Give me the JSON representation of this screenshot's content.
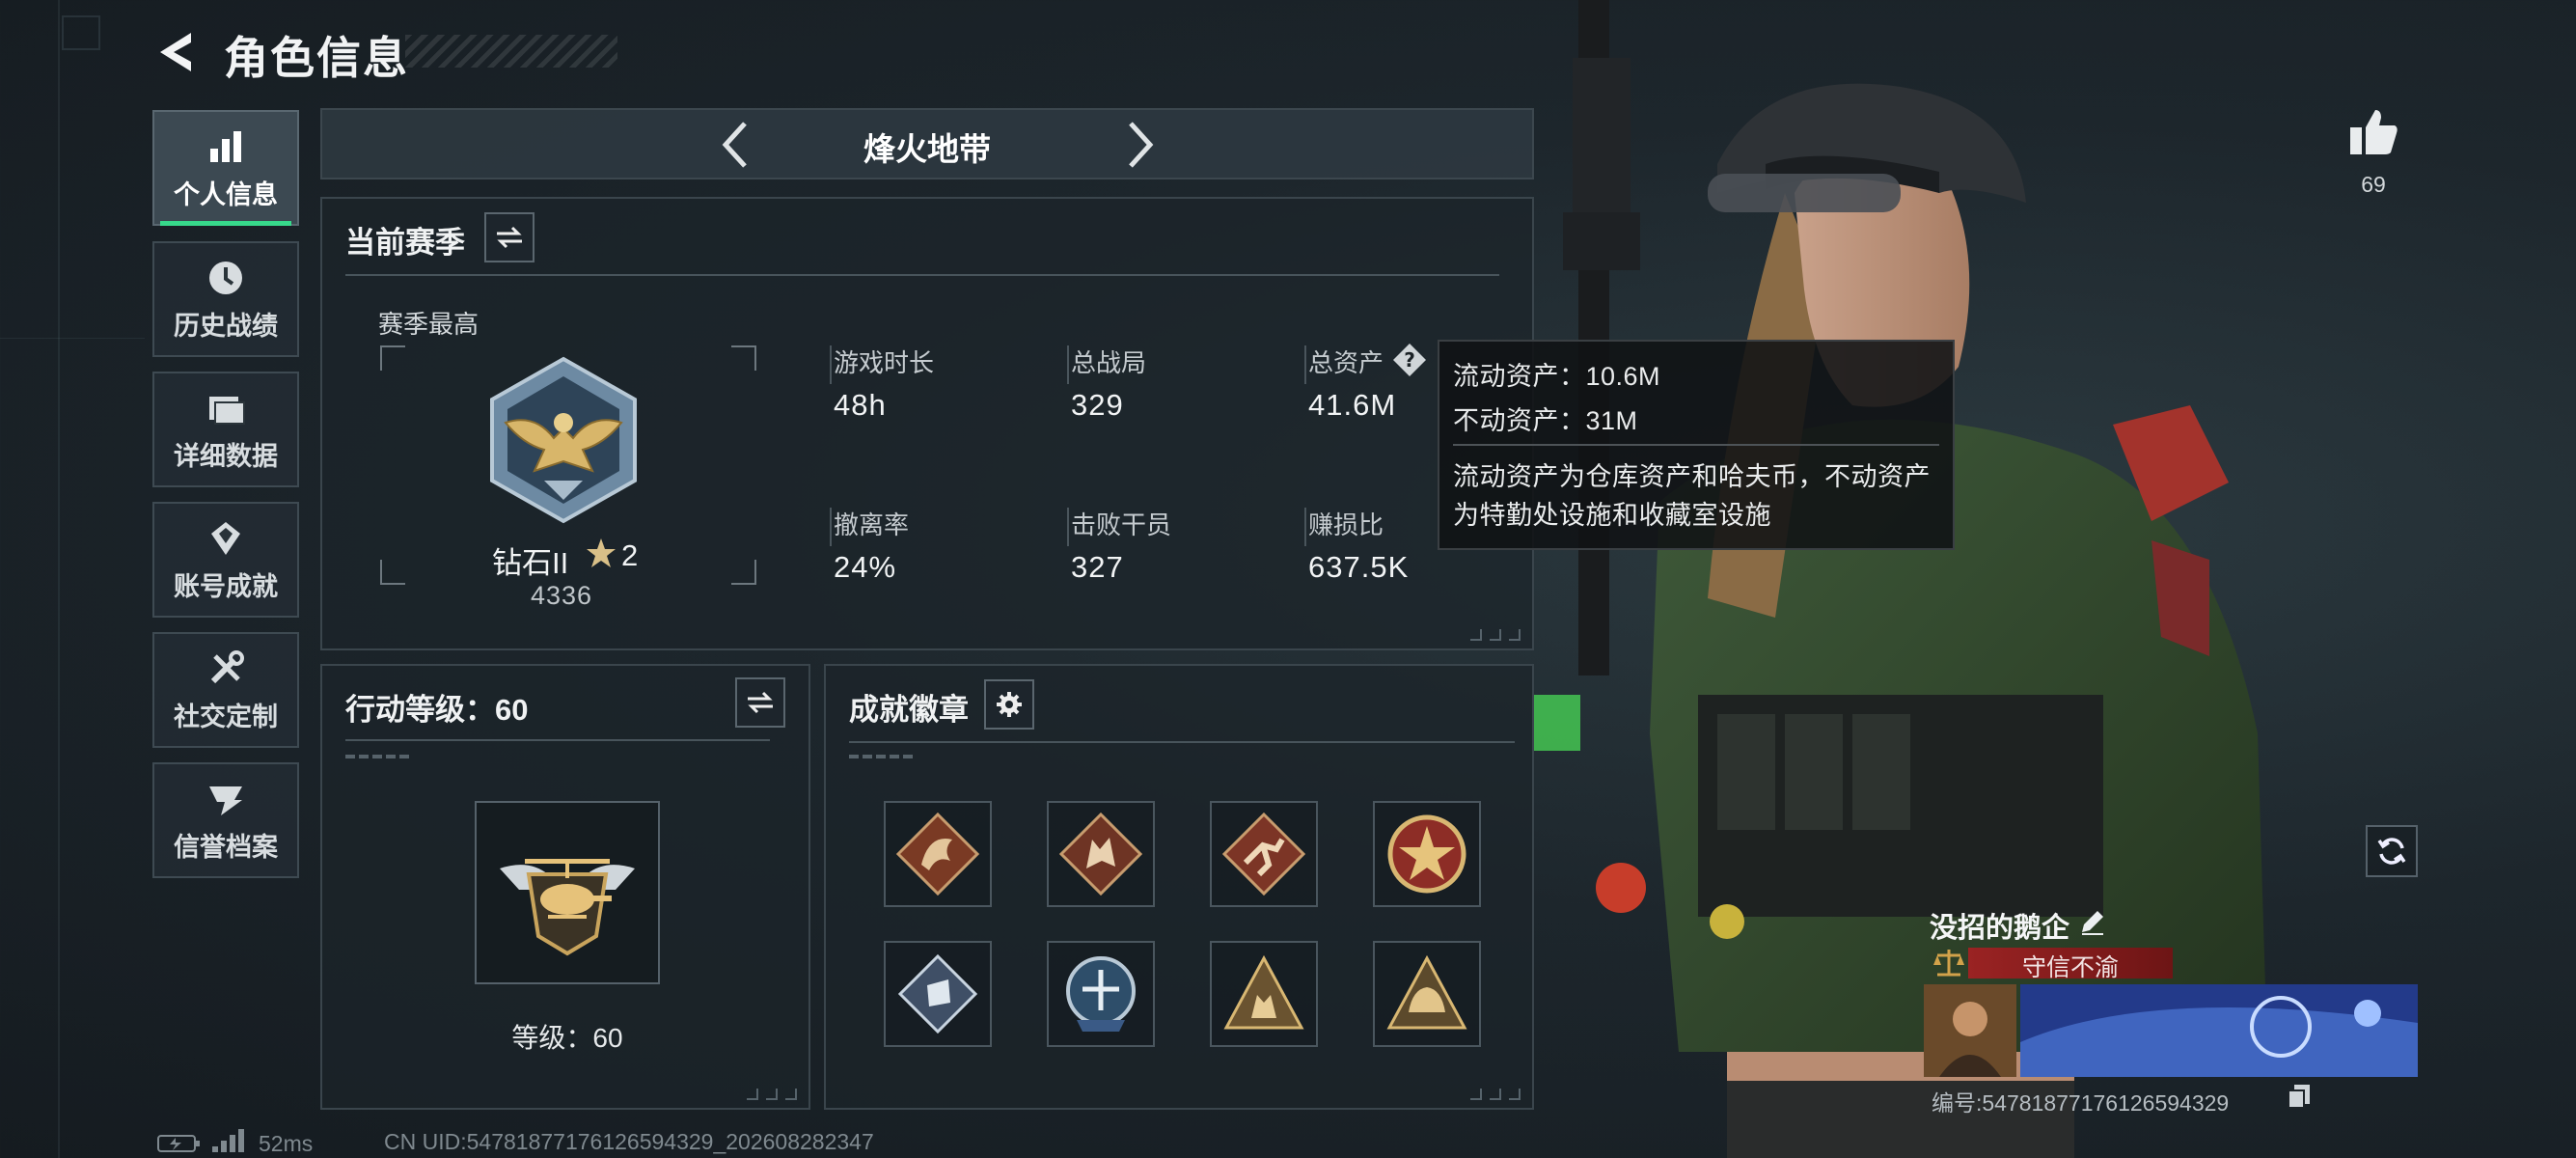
{
  "header": {
    "title": "角色信息"
  },
  "nav": {
    "items": [
      {
        "label": "个人信息",
        "icon": "bar-chart-icon",
        "active": true
      },
      {
        "label": "历史战绩",
        "icon": "clock-history-icon",
        "active": false
      },
      {
        "label": "详细数据",
        "icon": "folder-data-icon",
        "active": false
      },
      {
        "label": "账号成就",
        "icon": "achievement-icon",
        "active": false
      },
      {
        "label": "社交定制",
        "icon": "tools-icon",
        "active": false
      },
      {
        "label": "信誉档案",
        "icon": "credit-archive-icon",
        "active": false
      }
    ]
  },
  "mode": {
    "name": "烽火地带"
  },
  "season": {
    "title": "当前赛季",
    "best_label": "赛季最高",
    "rank_name": "钻石II",
    "rank_stars": "2",
    "rank_points": "4336",
    "stats": [
      {
        "label": "游戏时长",
        "value": "48h"
      },
      {
        "label": "总战局",
        "value": "329"
      },
      {
        "label": "总资产",
        "value": "41.6M"
      },
      {
        "label": "撤离率",
        "value": "24%"
      },
      {
        "label": "击败干员",
        "value": "327"
      },
      {
        "label": "赚损比",
        "value": "637.5K"
      }
    ]
  },
  "tooltip": {
    "liquid": "流动资产：10.6M",
    "fixed": "不动资产：31M",
    "desc_line1": "流动资产为仓库资产和哈夫币，不动资产",
    "desc_line2": "为特勤处设施和收藏室设施"
  },
  "action_level": {
    "title": "行动等级：60",
    "level_text": "等级：60"
  },
  "achievements": {
    "title": "成就徽章",
    "badges": [
      "dragon-badge-icon",
      "wolf-badge-icon",
      "runner-badge-icon",
      "star-medal-badge-icon",
      "crystal-badge-icon",
      "shield-emblem-badge-icon",
      "squad-badge-icon",
      "helmet-badge-icon"
    ]
  },
  "profile": {
    "likes": "69",
    "player_name": "没招的鹅企",
    "title": "守信不渝",
    "id_text": "编号:5478187717612659432​9"
  },
  "status": {
    "ping": "52ms",
    "uid": "CN UID:5478187717612659432​9_202608282347"
  },
  "colors": {
    "accent_green": "#37d98b",
    "title_red": "#9a2323",
    "panel_border": "#3a454c"
  }
}
